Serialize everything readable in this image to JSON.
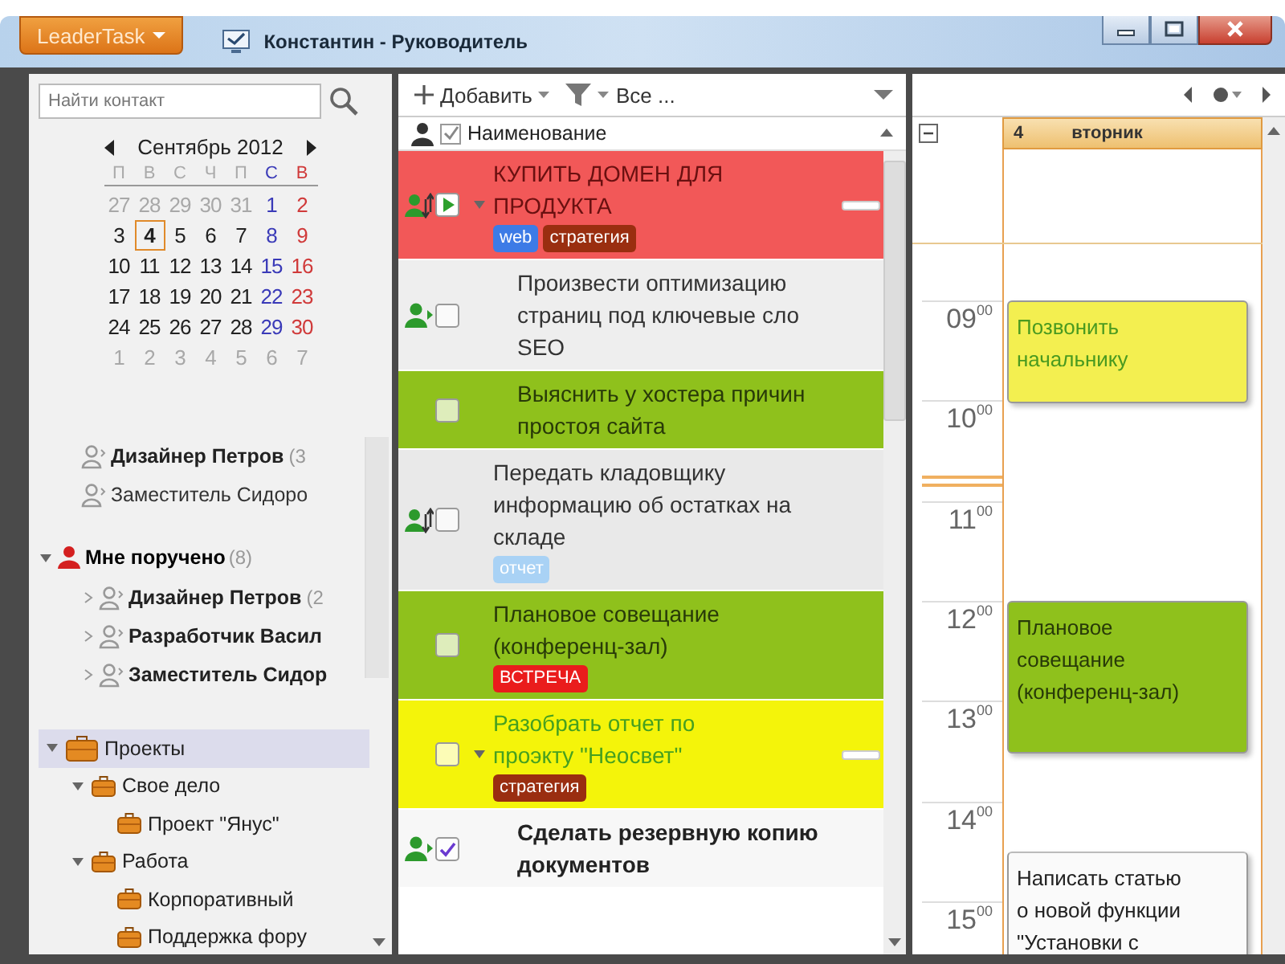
{
  "app_menu": {
    "label": "LeaderTask"
  },
  "window": {
    "title": "Константин - Руководитель"
  },
  "contacts": {
    "search": {
      "placeholder": "Найти контакт"
    },
    "calendar": {
      "month": "Сентябрь 2012",
      "weekdays": [
        "П",
        "В",
        "С",
        "Ч",
        "П",
        "С",
        "В"
      ],
      "weeks": [
        [
          {
            "day": "27",
            "muted": true,
            "selected": false
          },
          {
            "day": "28",
            "muted": true,
            "selected": false
          },
          {
            "day": "29",
            "muted": true,
            "selected": false
          },
          {
            "day": "30",
            "muted": true,
            "selected": false
          },
          {
            "day": "31",
            "muted": true,
            "selected": false
          },
          {
            "day": "1",
            "muted": false,
            "selected": false
          },
          {
            "day": "2",
            "muted": false,
            "selected": false
          }
        ],
        [
          {
            "day": "3",
            "muted": false,
            "selected": false
          },
          {
            "day": "4",
            "muted": false,
            "selected": true
          },
          {
            "day": "5",
            "muted": false,
            "selected": false
          },
          {
            "day": "6",
            "muted": false,
            "selected": false
          },
          {
            "day": "7",
            "muted": false,
            "selected": false
          },
          {
            "day": "8",
            "muted": false,
            "selected": false
          },
          {
            "day": "9",
            "muted": false,
            "selected": false
          }
        ],
        [
          {
            "day": "10",
            "muted": false,
            "selected": false
          },
          {
            "day": "11",
            "muted": false,
            "selected": false
          },
          {
            "day": "12",
            "muted": false,
            "selected": false
          },
          {
            "day": "13",
            "muted": false,
            "selected": false
          },
          {
            "day": "14",
            "muted": false,
            "selected": false
          },
          {
            "day": "15",
            "muted": false,
            "selected": false
          },
          {
            "day": "16",
            "muted": false,
            "selected": false
          }
        ],
        [
          {
            "day": "17",
            "muted": false,
            "selected": false
          },
          {
            "day": "18",
            "muted": false,
            "selected": false
          },
          {
            "day": "19",
            "muted": false,
            "selected": false
          },
          {
            "day": "20",
            "muted": false,
            "selected": false
          },
          {
            "day": "21",
            "muted": false,
            "selected": false
          },
          {
            "day": "22",
            "muted": false,
            "selected": false
          },
          {
            "day": "23",
            "muted": false,
            "selected": false
          }
        ],
        [
          {
            "day": "24",
            "muted": false,
            "selected": false
          },
          {
            "day": "25",
            "muted": false,
            "selected": false
          },
          {
            "day": "26",
            "muted": false,
            "selected": false
          },
          {
            "day": "27",
            "muted": false,
            "selected": false
          },
          {
            "day": "28",
            "muted": false,
            "selected": false
          },
          {
            "day": "29",
            "muted": false,
            "selected": false
          },
          {
            "day": "30",
            "muted": false,
            "selected": false
          }
        ],
        [
          {
            "day": "1",
            "muted": true,
            "selected": false
          },
          {
            "day": "2",
            "muted": true,
            "selected": false
          },
          {
            "day": "3",
            "muted": true,
            "selected": false
          },
          {
            "day": "4",
            "muted": true,
            "selected": false
          },
          {
            "day": "5",
            "muted": true,
            "selected": false
          },
          {
            "day": "6",
            "muted": true,
            "selected": false
          },
          {
            "day": "7",
            "muted": true,
            "selected": false
          }
        ]
      ]
    },
    "people": [
      {
        "name": "Дизайнер Петров",
        "count": "(3",
        "bold": true
      },
      {
        "name": "Заместитель Сидоро",
        "bold": false
      }
    ],
    "groups": [
      {
        "label": "Мне поручено",
        "count": "(8)",
        "expanded": true,
        "children": [
          {
            "name": "Дизайнер Петров",
            "count": "(2",
            "bold": true
          },
          {
            "name": "Разработчик Васил",
            "bold": true
          },
          {
            "name": "Заместитель Сидор",
            "bold": true
          }
        ]
      }
    ],
    "projects": [
      {
        "label": "Проекты",
        "expanded": true,
        "selected": true,
        "children": [
          {
            "label": "Свое дело",
            "expanded": true,
            "selected": false,
            "children": [
              {
                "label": "Проект \"Янус\"",
                "selected": false
              }
            ]
          },
          {
            "label": "Работа",
            "expanded": true,
            "selected": false,
            "children": [
              {
                "label": "Корпоративный",
                "selected": false
              },
              {
                "label": "Поддержка фору",
                "selected": false
              }
            ]
          }
        ]
      }
    ]
  },
  "toolbar": {
    "add": "Добавить",
    "filter": "Все ..."
  },
  "task_header": {
    "title": "Наименование"
  },
  "tasks": [
    {
      "title": {
        "text": "КУПИТЬ ДОМЕН ДЛЯ\nПРОДУКТА",
        "color": "#6a1010"
      },
      "kind": "play",
      "checked": false,
      "assigned": true,
      "delegated": true,
      "color": "#f25858",
      "bold": false,
      "bar": true,
      "expanded": true,
      "tags": [
        {
          "label": "web",
          "color": "#3d7be6"
        },
        {
          "label": "стратегия",
          "color": "#9a2e10"
        }
      ],
      "children": [
        {
          "title": {
            "text": "Произвести оптимизацию\nстраниц под ключевые сло\nSEO",
            "color": "#333333"
          },
          "kind": "box",
          "checked": false,
          "assigned": true,
          "delegated": false,
          "color": "#eeeeee",
          "bold": false,
          "bar": false
        },
        {
          "title": {
            "text": "Выяснить у хостера причин\nпростоя сайта",
            "color": "#283a08"
          },
          "kind": "box",
          "checked": false,
          "assigned": false,
          "color": "#8fc11c",
          "bold": false,
          "bar": false
        }
      ]
    },
    {
      "title": {
        "text": "Передать кладовщику\nинформацию об остатках на\nскладе",
        "color": "#333333"
      },
      "kind": "box",
      "checked": false,
      "assigned": true,
      "delegated": true,
      "color": "#e9e9e9",
      "bold": false,
      "bar": false,
      "tags": [
        {
          "label": "отчет",
          "color": "#a9d2f5"
        }
      ]
    },
    {
      "title": {
        "text": "Плановое совещание\n(конференц-зал)",
        "color": "#283a08"
      },
      "kind": "box",
      "checked": false,
      "assigned": false,
      "color": "#8fc11c",
      "bold": false,
      "bar": false,
      "tags": [
        {
          "label": "ВСТРЕЧА",
          "color": "#ea1c1c"
        }
      ]
    },
    {
      "title": {
        "text": "Разобрать отчет по\nпроэкту \"Неосвет\"",
        "color": "#46a020"
      },
      "kind": "box",
      "checked": false,
      "assigned": false,
      "color": "#f4f40a",
      "bold": false,
      "bar": true,
      "expanded": true,
      "tags": [
        {
          "label": "стратегия",
          "color": "#9a2e10"
        }
      ],
      "children": [
        {
          "title": {
            "text": "Сделать резервную копию\nдокументов",
            "color": "#222222"
          },
          "kind": "box",
          "checked": true,
          "assigned": true,
          "delegated": false,
          "color": "#f7f7f7",
          "bold": true,
          "bar": false
        }
      ]
    }
  ],
  "day_view": {
    "number": "4",
    "weekday": "вторник",
    "hours": [
      {
        "label": "09$^{00}$",
        "events": [
          {
            "title": {
              "text": "Позвонить\nначальнику",
              "color": "#4a9a20"
            },
            "color": "#f3ef50",
            "kind": "hour",
            "half_past": false
          }
        ]
      },
      {
        "label": "10$^{00}$",
        "current_time": true
      },
      {
        "label": "11$^{00}$"
      },
      {
        "label": "12$^{00}$",
        "events": [
          {
            "title": {
              "text": "Плановое\nсовещание\n(конференц-зал)",
              "color": "#283a08"
            },
            "color": "#8fc11c",
            "kind": "long",
            "half_past": false
          }
        ]
      },
      {
        "label": "13$^{00}$"
      },
      {
        "label": "14$^{00}$",
        "events": [
          {
            "title": {
              "text": "Написать статью\nо новой функции\n\"Установки с",
              "color": "#222222"
            },
            "color": "#fafafa",
            "kind": "long",
            "half_past": true
          }
        ]
      },
      {
        "label": "15$^{00}$"
      }
    ]
  }
}
